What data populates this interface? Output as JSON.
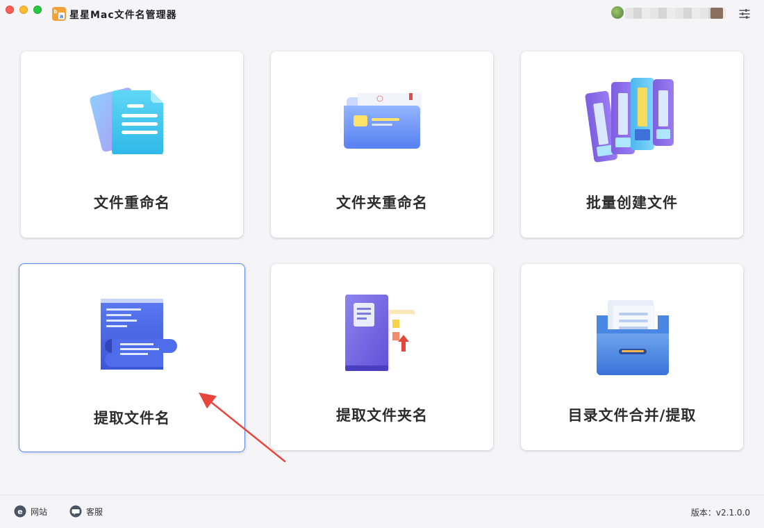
{
  "app": {
    "title": "星星Mac文件名管理器"
  },
  "cards": [
    {
      "label": "文件重命名"
    },
    {
      "label": "文件夹重命名"
    },
    {
      "label": "批量创建文件"
    },
    {
      "label": "提取文件名"
    },
    {
      "label": "提取文件夹名"
    },
    {
      "label": "目录文件合并/提取"
    }
  ],
  "footer": {
    "website": "网站",
    "support": "客服",
    "version": "版本：v2.1.0.0"
  },
  "colors": {
    "accent": "#5b86e5",
    "annotation_arrow": "#e8453c"
  }
}
